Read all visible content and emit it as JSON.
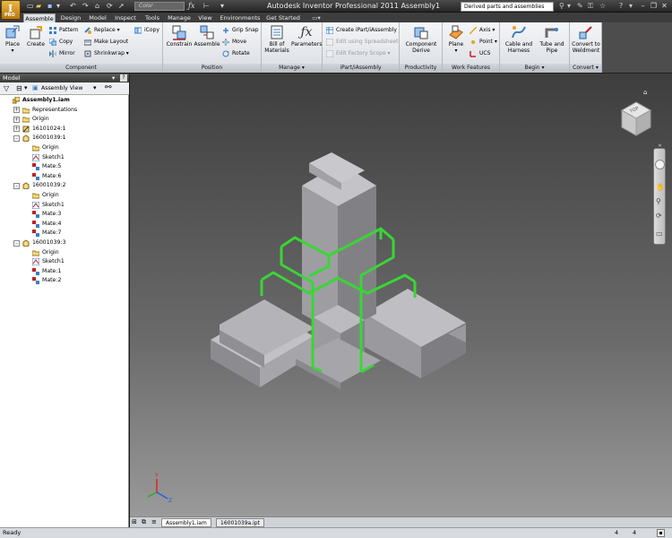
{
  "titlebar": {
    "app_badge": "PRO",
    "color_combo": "Color",
    "window_title": "Autodesk Inventor Professional 2011    Assembly1",
    "search_value": "Derived parts and assemblies"
  },
  "tabs": [
    "Assemble",
    "Design",
    "Model",
    "Inspect",
    "Tools",
    "Manage",
    "View",
    "Environments",
    "Get Started"
  ],
  "ribbon": {
    "component": {
      "title": "Component",
      "place": "Place",
      "create": "Create",
      "pattern": "Pattern",
      "copy": "Copy",
      "mirror": "Mirror",
      "replace": "Replace",
      "make_layout": "Make Layout",
      "shrinkwrap": "Shrinkwrap",
      "icopy": "iCopy"
    },
    "position": {
      "title": "Position",
      "constrain": "Constrain",
      "assemble": "Assemble",
      "grip_snap": "Grip Snap",
      "move": "Move",
      "rotate": "Rotate"
    },
    "manage": {
      "title": "Manage",
      "bom_line1": "Bill of",
      "bom_line2": "Materials",
      "parameters": "Parameters"
    },
    "ipart": {
      "title": "iPart/iAssembly",
      "create": "Create iPart/iAssembly",
      "edit_spreadsheet": "Edit using Spreadsheet",
      "edit_factory": "Edit Factory Scope"
    },
    "productivity": {
      "title": "Productivity",
      "line1": "Component",
      "line2": "Derive"
    },
    "work_features": {
      "title": "Work Features",
      "plane": "Plane",
      "axis": "Axis",
      "point": "Point",
      "ucs": "UCS"
    },
    "begin": {
      "title": "Begin",
      "cable_line1": "Cable and",
      "cable_line2": "Harness",
      "tube_line1": "Tube and",
      "tube_line2": "Pipe"
    },
    "convert": {
      "title": "Convert",
      "line1": "Convert to",
      "line2": "Weldment"
    }
  },
  "browser": {
    "title": "Model",
    "help": "?",
    "view_combo": "Assembly View",
    "tree": [
      {
        "label": "Assembly1.iam",
        "icon": "assembly-icon",
        "bold": true
      },
      {
        "label": "Representations",
        "icon": "folder-icon"
      },
      {
        "label": "Origin",
        "icon": "folder-icon"
      },
      {
        "label": "16101024:1",
        "icon": "grounded-part-icon"
      },
      {
        "label": "16001039:1",
        "icon": "part-icon"
      },
      {
        "label": "Origin",
        "icon": "folder-icon"
      },
      {
        "label": "Sketch1",
        "icon": "sketch-icon"
      },
      {
        "label": "Mate:5",
        "icon": "mate-icon"
      },
      {
        "label": "Mate:6",
        "icon": "mate-icon"
      },
      {
        "label": "16001039:2",
        "icon": "part-icon"
      },
      {
        "label": "Origin",
        "icon": "folder-icon"
      },
      {
        "label": "Sketch1",
        "icon": "sketch-icon"
      },
      {
        "label": "Mate:3",
        "icon": "mate-icon"
      },
      {
        "label": "Mate:4",
        "icon": "mate-icon"
      },
      {
        "label": "Mate:7",
        "icon": "mate-icon"
      },
      {
        "label": "16001039:3",
        "icon": "part-icon"
      },
      {
        "label": "Origin",
        "icon": "folder-icon"
      },
      {
        "label": "Sketch1",
        "icon": "sketch-icon"
      },
      {
        "label": "Mate:1",
        "icon": "mate-icon"
      },
      {
        "label": "Mate:2",
        "icon": "mate-icon"
      }
    ]
  },
  "viewcube": {
    "face_label": "TOP"
  },
  "doc_tabs": [
    "Assembly1.iam",
    "16001039a.ipt"
  ],
  "status": {
    "text": "Ready",
    "count1": "4",
    "count2": "4"
  },
  "colors": {
    "highlight": "#39d636",
    "part_face": "#a9a9ad",
    "brand": "#d9951f"
  }
}
